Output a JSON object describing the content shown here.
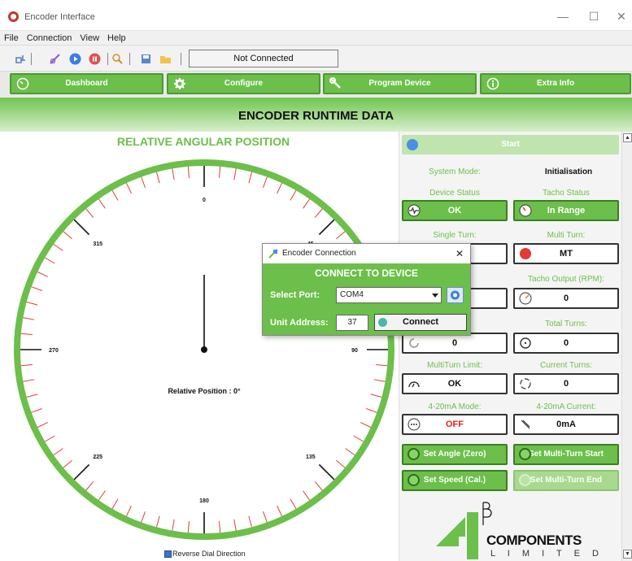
{
  "window": {
    "title": "Encoder Interface",
    "min": "—",
    "max": "☐",
    "close": "✕"
  },
  "menu": [
    "File",
    "Connection",
    "View",
    "Help"
  ],
  "toolbar": {
    "status": "Not Connected"
  },
  "nav": [
    {
      "label": "Dashboard",
      "icon": "dashboard-icon"
    },
    {
      "label": "Configure",
      "icon": "gear-icon"
    },
    {
      "label": "Program Device",
      "icon": "wrench-icon"
    },
    {
      "label": "Extra Info",
      "icon": "info-icon"
    }
  ],
  "header": "ENCODER RUNTIME DATA",
  "dial": {
    "heading": "RELATIVE ANGULAR POSITION",
    "labels": [
      "0",
      "45",
      "90",
      "135",
      "180",
      "225",
      "270",
      "315"
    ],
    "position_text": "Relative Position : 0°",
    "angle_deg": 0,
    "reverse_label": "Reverse Dial Direction"
  },
  "panel": {
    "start": "Start",
    "system_mode_label": "System Mode:",
    "system_mode_value": "Initialisation",
    "device_status_label": "Device Status",
    "device_status_value": "OK",
    "tacho_status_label": "Tacho Status",
    "tacho_status_value": "In Range",
    "single_turn_label": "Single Turn:",
    "multi_turn_label": "Multi Turn:",
    "multi_turn_value": "MT",
    "freq_label": "(Hz):",
    "tacho_output_label": "Tacho Output (RPM):",
    "tacho_output_value": "0",
    "percent_label": "ent %:",
    "percent_value": "0",
    "total_turns_label": "Total Turns:",
    "total_turns_value": "0",
    "multiturn_limit_label": "MultiTurn Limit:",
    "multiturn_limit_value": "OK",
    "current_turns_label": "Current Turns:",
    "current_turns_value": "0",
    "ma_mode_label": "4-20mA Mode:",
    "ma_mode_value": "OFF",
    "ma_current_label": "4-20mA Current:",
    "ma_current_value": "0mA",
    "set_angle": "Set Angle (Zero)",
    "set_mt_start": "Set Multi-Turn Start",
    "set_speed": "Set Speed (Cal.)",
    "set_mt_end": "Set Multi-Turn End"
  },
  "logo": {
    "main": "COMPONENTS",
    "sub": "L I M I T E D",
    "mark": "4B"
  },
  "dialog": {
    "title": "Encoder Connection",
    "heading": "CONNECT TO DEVICE",
    "port_label": "Select Port:",
    "port_value": "COM4",
    "address_label": "Unit Address:",
    "address_value": "37",
    "connect": "Connect",
    "close": "✕"
  },
  "colors": {
    "accent": "#6cbf4a",
    "dark_green": "#3a7f22",
    "red": "#e02020",
    "blue": "#4a90e2"
  }
}
